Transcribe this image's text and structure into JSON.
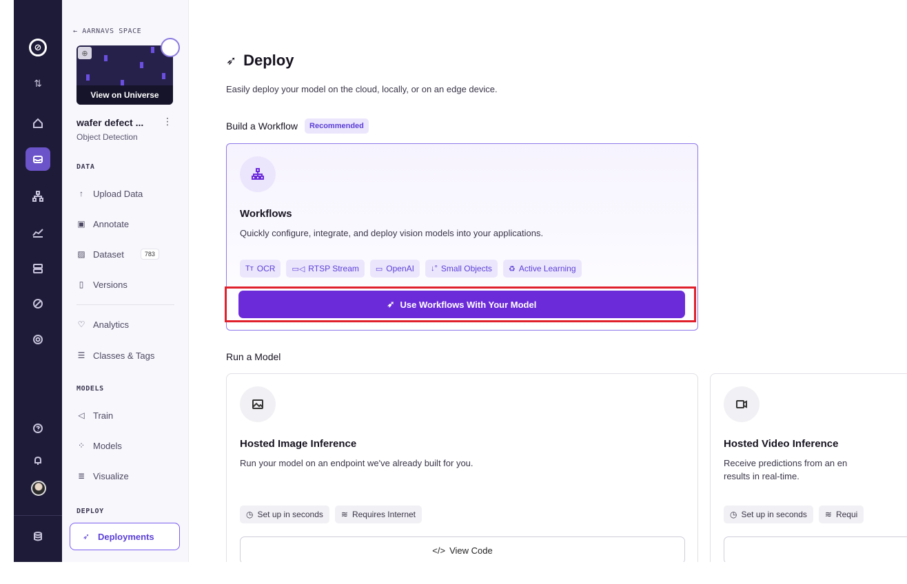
{
  "rail": {
    "logo": "⊘",
    "icons": [
      "swap-icon",
      "home-icon",
      "inbox-icon",
      "workflow-icon",
      "chart-icon",
      "storage-icon",
      "compass-icon",
      "settings-icon",
      "help-icon",
      "bell-icon",
      "avatar",
      "database-icon"
    ]
  },
  "sidebar": {
    "back_label": "← AARNAVS SPACE",
    "view_on_universe": "View on Universe",
    "project_name": "wafer defect ...",
    "project_menu": "⋮",
    "project_type": "Object Detection",
    "data_heading": "DATA",
    "upload_data": "Upload Data",
    "annotate": "Annotate",
    "dataset": "Dataset",
    "dataset_count": "783",
    "versions": "Versions",
    "analytics": "Analytics",
    "classes_tags": "Classes & Tags",
    "models_heading": "MODELS",
    "train": "Train",
    "models": "Models",
    "visualize": "Visualize",
    "deploy_heading": "DEPLOY",
    "deployments": "Deployments"
  },
  "main": {
    "title": "Deploy",
    "subtitle": "Easily deploy your model on the cloud, locally, or on an edge device.",
    "build_workflow": "Build a Workflow",
    "recommended": "Recommended",
    "workflows_title": "Workflows",
    "workflows_desc": "Quickly configure, integrate, and deploy vision models into your applications.",
    "chips": {
      "ocr": "OCR",
      "rtsp": "RTSP Stream",
      "openai": "OpenAI",
      "small_objects": "Small Objects",
      "active_learning": "Active Learning"
    },
    "use_workflows_btn": "Use Workflows With Your Model",
    "run_model": "Run a Model",
    "hosted_image": {
      "title": "Hosted Image Inference",
      "desc": "Run your model on an endpoint we've already built for you.",
      "chip_setup": "Set up in seconds",
      "chip_internet": "Requires Internet",
      "view_code": "View Code"
    },
    "hosted_video": {
      "title": "Hosted Video Inference",
      "desc_line1": "Receive predictions from an en",
      "desc_line2": "results in real-time.",
      "chip_setup": "Set up in seconds",
      "chip_internet": "Requi"
    }
  },
  "colors": {
    "rail_bg": "#1e1b38",
    "accent": "#6c2bd9",
    "chip_bg": "#ece6fd",
    "highlight": "#e0202a"
  }
}
